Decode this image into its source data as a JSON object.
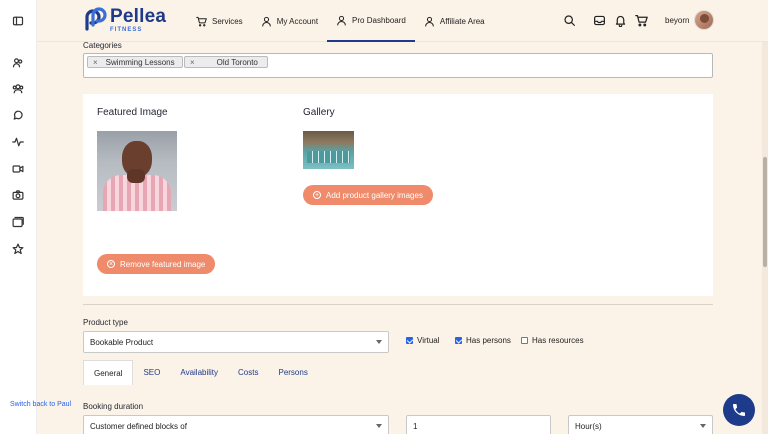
{
  "header": {
    "brand_name": "Pellea",
    "brand_sub": "FITNESS",
    "nav": [
      {
        "label": "Services",
        "icon": "cart-icon"
      },
      {
        "label": "My Account",
        "icon": "user-icon"
      },
      {
        "label": "Pro Dashboard",
        "icon": "user-icon",
        "active": true
      },
      {
        "label": "Affiliate Area",
        "icon": "user-icon"
      }
    ],
    "username": "beyorn"
  },
  "form": {
    "categories_label": "Categories",
    "categories": [
      "Swimming Lessons",
      "Old Toronto"
    ],
    "tag_remove": "×",
    "featured_image_title": "Featured Image",
    "gallery_title": "Gallery",
    "add_gallery_label": "Add product gallery images",
    "remove_featured_label": "Remove featured image",
    "product_type_label": "Product type",
    "product_type_value": "Bookable Product",
    "virtual_label": "Virtual",
    "virtual_checked": true,
    "has_persons_label": "Has persons",
    "has_persons_checked": true,
    "has_resources_label": "Has resources",
    "has_resources_checked": false,
    "tabs": [
      "General",
      "SEO",
      "Availability",
      "Costs",
      "Persons"
    ],
    "active_tab": "General",
    "booking_duration_label": "Booking duration",
    "duration_type_value": "Customer defined blocks of",
    "duration_amount_value": "1",
    "duration_unit_value": "Hour(s)"
  },
  "footer": {
    "switch_back_label": "Switch back to Paul"
  },
  "colors": {
    "accent": "#1e3a8a",
    "button_orange": "#ef8a6a",
    "background": "#fcf3e8"
  }
}
